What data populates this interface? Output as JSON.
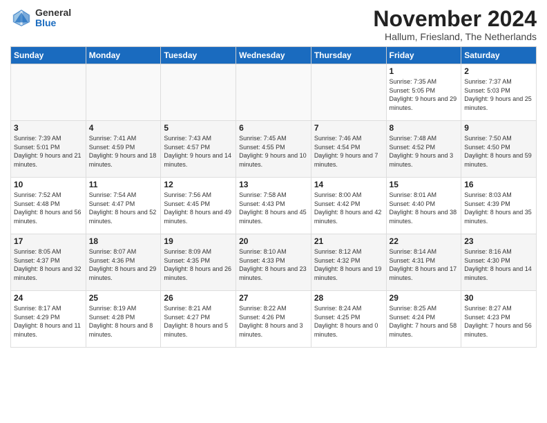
{
  "header": {
    "logo_general": "General",
    "logo_blue": "Blue",
    "month_title": "November 2024",
    "location": "Hallum, Friesland, The Netherlands"
  },
  "weekdays": [
    "Sunday",
    "Monday",
    "Tuesday",
    "Wednesday",
    "Thursday",
    "Friday",
    "Saturday"
  ],
  "weeks": [
    [
      {
        "day": "",
        "info": ""
      },
      {
        "day": "",
        "info": ""
      },
      {
        "day": "",
        "info": ""
      },
      {
        "day": "",
        "info": ""
      },
      {
        "day": "",
        "info": ""
      },
      {
        "day": "1",
        "info": "Sunrise: 7:35 AM\nSunset: 5:05 PM\nDaylight: 9 hours and 29 minutes."
      },
      {
        "day": "2",
        "info": "Sunrise: 7:37 AM\nSunset: 5:03 PM\nDaylight: 9 hours and 25 minutes."
      }
    ],
    [
      {
        "day": "3",
        "info": "Sunrise: 7:39 AM\nSunset: 5:01 PM\nDaylight: 9 hours and 21 minutes."
      },
      {
        "day": "4",
        "info": "Sunrise: 7:41 AM\nSunset: 4:59 PM\nDaylight: 9 hours and 18 minutes."
      },
      {
        "day": "5",
        "info": "Sunrise: 7:43 AM\nSunset: 4:57 PM\nDaylight: 9 hours and 14 minutes."
      },
      {
        "day": "6",
        "info": "Sunrise: 7:45 AM\nSunset: 4:55 PM\nDaylight: 9 hours and 10 minutes."
      },
      {
        "day": "7",
        "info": "Sunrise: 7:46 AM\nSunset: 4:54 PM\nDaylight: 9 hours and 7 minutes."
      },
      {
        "day": "8",
        "info": "Sunrise: 7:48 AM\nSunset: 4:52 PM\nDaylight: 9 hours and 3 minutes."
      },
      {
        "day": "9",
        "info": "Sunrise: 7:50 AM\nSunset: 4:50 PM\nDaylight: 8 hours and 59 minutes."
      }
    ],
    [
      {
        "day": "10",
        "info": "Sunrise: 7:52 AM\nSunset: 4:48 PM\nDaylight: 8 hours and 56 minutes."
      },
      {
        "day": "11",
        "info": "Sunrise: 7:54 AM\nSunset: 4:47 PM\nDaylight: 8 hours and 52 minutes."
      },
      {
        "day": "12",
        "info": "Sunrise: 7:56 AM\nSunset: 4:45 PM\nDaylight: 8 hours and 49 minutes."
      },
      {
        "day": "13",
        "info": "Sunrise: 7:58 AM\nSunset: 4:43 PM\nDaylight: 8 hours and 45 minutes."
      },
      {
        "day": "14",
        "info": "Sunrise: 8:00 AM\nSunset: 4:42 PM\nDaylight: 8 hours and 42 minutes."
      },
      {
        "day": "15",
        "info": "Sunrise: 8:01 AM\nSunset: 4:40 PM\nDaylight: 8 hours and 38 minutes."
      },
      {
        "day": "16",
        "info": "Sunrise: 8:03 AM\nSunset: 4:39 PM\nDaylight: 8 hours and 35 minutes."
      }
    ],
    [
      {
        "day": "17",
        "info": "Sunrise: 8:05 AM\nSunset: 4:37 PM\nDaylight: 8 hours and 32 minutes."
      },
      {
        "day": "18",
        "info": "Sunrise: 8:07 AM\nSunset: 4:36 PM\nDaylight: 8 hours and 29 minutes."
      },
      {
        "day": "19",
        "info": "Sunrise: 8:09 AM\nSunset: 4:35 PM\nDaylight: 8 hours and 26 minutes."
      },
      {
        "day": "20",
        "info": "Sunrise: 8:10 AM\nSunset: 4:33 PM\nDaylight: 8 hours and 23 minutes."
      },
      {
        "day": "21",
        "info": "Sunrise: 8:12 AM\nSunset: 4:32 PM\nDaylight: 8 hours and 19 minutes."
      },
      {
        "day": "22",
        "info": "Sunrise: 8:14 AM\nSunset: 4:31 PM\nDaylight: 8 hours and 17 minutes."
      },
      {
        "day": "23",
        "info": "Sunrise: 8:16 AM\nSunset: 4:30 PM\nDaylight: 8 hours and 14 minutes."
      }
    ],
    [
      {
        "day": "24",
        "info": "Sunrise: 8:17 AM\nSunset: 4:29 PM\nDaylight: 8 hours and 11 minutes."
      },
      {
        "day": "25",
        "info": "Sunrise: 8:19 AM\nSunset: 4:28 PM\nDaylight: 8 hours and 8 minutes."
      },
      {
        "day": "26",
        "info": "Sunrise: 8:21 AM\nSunset: 4:27 PM\nDaylight: 8 hours and 5 minutes."
      },
      {
        "day": "27",
        "info": "Sunrise: 8:22 AM\nSunset: 4:26 PM\nDaylight: 8 hours and 3 minutes."
      },
      {
        "day": "28",
        "info": "Sunrise: 8:24 AM\nSunset: 4:25 PM\nDaylight: 8 hours and 0 minutes."
      },
      {
        "day": "29",
        "info": "Sunrise: 8:25 AM\nSunset: 4:24 PM\nDaylight: 7 hours and 58 minutes."
      },
      {
        "day": "30",
        "info": "Sunrise: 8:27 AM\nSunset: 4:23 PM\nDaylight: 7 hours and 56 minutes."
      }
    ]
  ]
}
